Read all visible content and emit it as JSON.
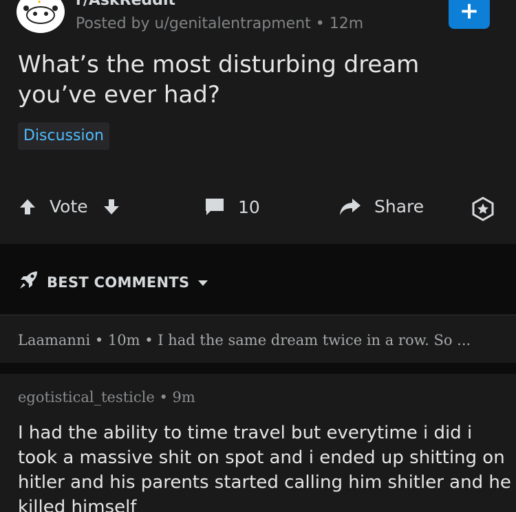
{
  "post": {
    "subreddit": "r/AskReddit",
    "meta": "Posted by u/genitalentrapment • 12m",
    "join_label": "+",
    "title": "What’s the most disturbing dream you’ve ever had?",
    "flair": "Discussion"
  },
  "actions": {
    "vote_label": "Vote",
    "comment_count": "10",
    "share_label": "Share"
  },
  "sort": {
    "label": "BEST COMMENTS"
  },
  "collapsed_comment": {
    "text": "Laamanni • 10m • I had the same dream twice in a row. So ..."
  },
  "comment": {
    "meta": "egotistical_testicle • 9m",
    "body": "I had the ability to time travel but everytime i did i took a massive shit on spot and i ended up shitting on hitler and his parents started calling him shitler and he killed himself"
  },
  "colors": {
    "background": "#1a1a1b",
    "join_button": "#0d7fd6",
    "flair_text": "#4fbcff",
    "sort_bar": "#0c0c0c"
  }
}
